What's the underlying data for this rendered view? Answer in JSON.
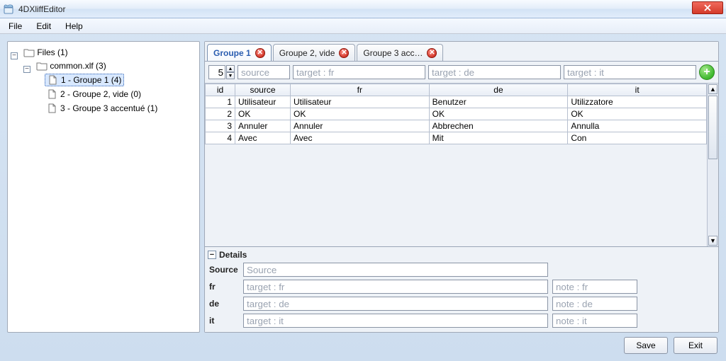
{
  "window": {
    "title": "4DXliffEditor"
  },
  "menubar": {
    "file": "File",
    "edit": "Edit",
    "help": "Help"
  },
  "tree": {
    "root": {
      "label": "Files (1)"
    },
    "file": {
      "label": "common.xlf (3)"
    },
    "groups": [
      {
        "label": "1 - Groupe 1 (4)",
        "selected": true
      },
      {
        "label": "2 - Groupe 2, vide (0)",
        "selected": false
      },
      {
        "label": "3 - Groupe 3 accentué (1)",
        "selected": false
      }
    ]
  },
  "tabs": [
    {
      "label": "Groupe 1",
      "active": true
    },
    {
      "label": "Groupe 2, vide",
      "active": false
    },
    {
      "label": "Groupe 3 acc…",
      "active": false
    }
  ],
  "quickrow": {
    "id": "5",
    "placeholders": {
      "source": "source",
      "fr": "target : fr",
      "de": "target : de",
      "it": "target : it"
    }
  },
  "columns": {
    "id": "id",
    "source": "source",
    "fr": "fr",
    "de": "de",
    "it": "it"
  },
  "rows": [
    {
      "id": "1",
      "source": "Utilisateur",
      "fr": "Utilisateur",
      "de": "Benutzer",
      "it": "Utilizzatore"
    },
    {
      "id": "2",
      "source": "OK",
      "fr": "OK",
      "de": "OK",
      "it": "OK"
    },
    {
      "id": "3",
      "source": "Annuler",
      "fr": "Annuler",
      "de": "Abbrechen",
      "it": "Annulla"
    },
    {
      "id": "4",
      "source": "Avec",
      "fr": "Avec",
      "de": "Mit",
      "it": "Con"
    }
  ],
  "details": {
    "header": "Details",
    "labels": {
      "source": "Source",
      "fr": "fr",
      "de": "de",
      "it": "it"
    },
    "placeholders": {
      "source": "Source",
      "fr_target": "target : fr",
      "fr_note": "note : fr",
      "de_target": "target : de",
      "de_note": "note : de",
      "it_target": "target : it",
      "it_note": "note : it"
    }
  },
  "footer": {
    "save": "Save",
    "exit": "Exit"
  }
}
